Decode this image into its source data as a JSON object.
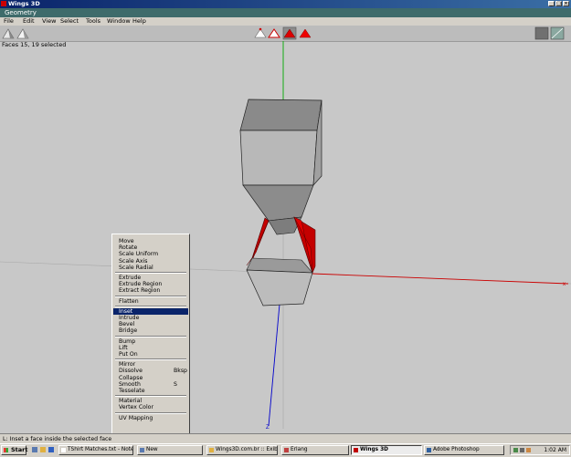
{
  "window": {
    "title": "Wings 3D",
    "controls": [
      "_",
      "□",
      "×"
    ]
  },
  "geometry_title": "Geometry",
  "menubar": [
    "File",
    "Edit",
    "View",
    "Select",
    "Tools",
    "Window",
    "Help"
  ],
  "status": "Faces 15, 19 selected",
  "context_menu": {
    "items": [
      {
        "label": "Move",
        "kind": "sub"
      },
      {
        "label": "Rotate",
        "kind": "sub"
      },
      {
        "label": "Scale Uniform",
        "kind": "sub"
      },
      {
        "label": "Scale Axis",
        "kind": "sub"
      },
      {
        "label": "Scale Radial",
        "kind": "sub"
      },
      {
        "sep": true
      },
      {
        "label": "Extrude",
        "kind": "sub"
      },
      {
        "label": "Extrude Region",
        "kind": "sub"
      },
      {
        "label": "Extract Region",
        "kind": "sub"
      },
      {
        "sep": true
      },
      {
        "label": "Flatten",
        "kind": "sub"
      },
      {
        "sep": true
      },
      {
        "label": "Inset",
        "highlighted": true
      },
      {
        "label": "Intrude"
      },
      {
        "label": "Bevel"
      },
      {
        "label": "Bridge"
      },
      {
        "sep": true
      },
      {
        "label": "Bump"
      },
      {
        "label": "Lift",
        "kind": "sub"
      },
      {
        "label": "Put On",
        "kind": "sub"
      },
      {
        "sep": true
      },
      {
        "label": "Mirror",
        "kind": "sub"
      },
      {
        "label": "Dissolve",
        "shortcut": "Bksp"
      },
      {
        "label": "Collapse"
      },
      {
        "label": "Smooth",
        "shortcut": "S"
      },
      {
        "label": "Tesselate"
      },
      {
        "sep": true
      },
      {
        "label": "Material",
        "kind": "sub"
      },
      {
        "label": "Vertex Color"
      },
      {
        "sep": true
      },
      {
        "label": "UV Mapping"
      }
    ]
  },
  "info_line": "L: Inset a face inside the selected face",
  "taskbar": {
    "start": "Start",
    "tasks": [
      {
        "label": "TShirt Matches.txt - Note..."
      },
      {
        "label": "New"
      },
      {
        "label": "Wings3D.com.br :: Exibir ..."
      },
      {
        "label": "Erlang"
      },
      {
        "label": "Wings 3D",
        "active": true
      },
      {
        "label": "Adobe Photoshop"
      }
    ],
    "clock": "1:02 AM"
  },
  "axis_label": "Z",
  "colors": {
    "selected_face": "#cc0000",
    "highlight": "#0a246a",
    "x_axis": "#cc0000",
    "y_axis": "#00aa00",
    "z_axis": "#0000cc"
  }
}
